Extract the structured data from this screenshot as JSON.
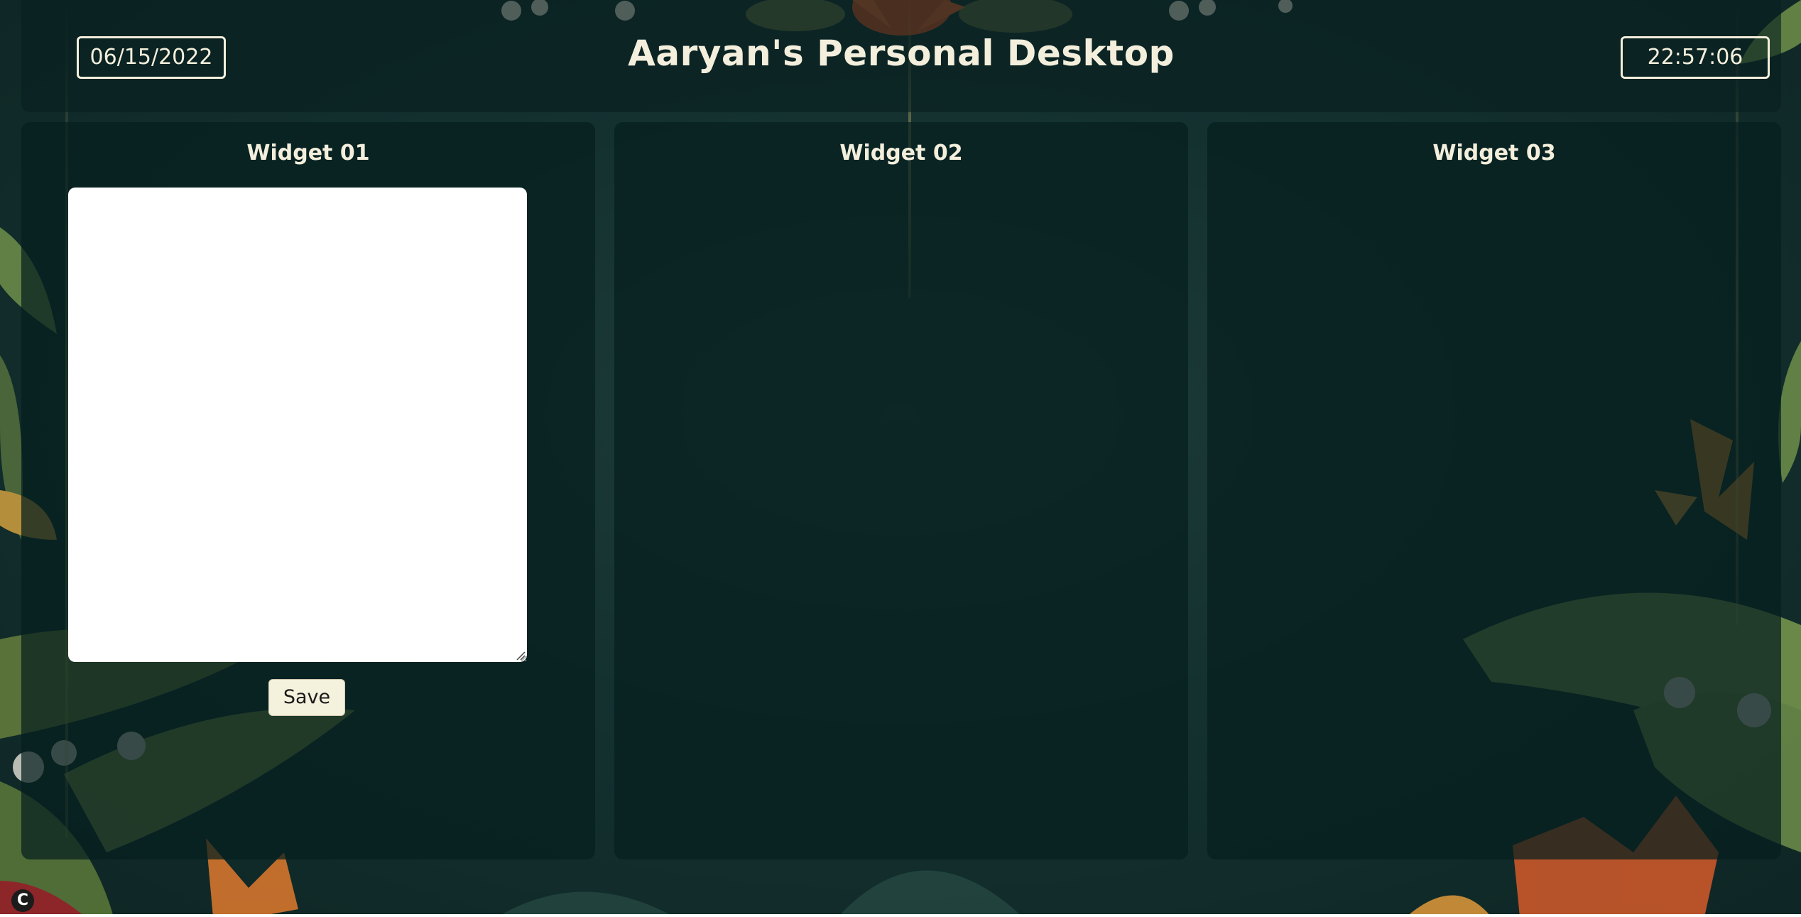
{
  "header": {
    "date": "06/15/2022",
    "title": "Aaryan's Personal Desktop",
    "time": "22:57:06"
  },
  "widgets": [
    {
      "title": "Widget 01",
      "notes": {
        "value": "",
        "placeholder": ""
      },
      "save_label": "Save"
    },
    {
      "title": "Widget 02"
    },
    {
      "title": "Widget 03"
    }
  ],
  "corner_badge": {
    "icon": "c-logo-icon",
    "letter": "C"
  },
  "colors": {
    "text": "#f3efdc",
    "panel": "#062020",
    "button": "#f4f1dc",
    "background": "#143130"
  }
}
